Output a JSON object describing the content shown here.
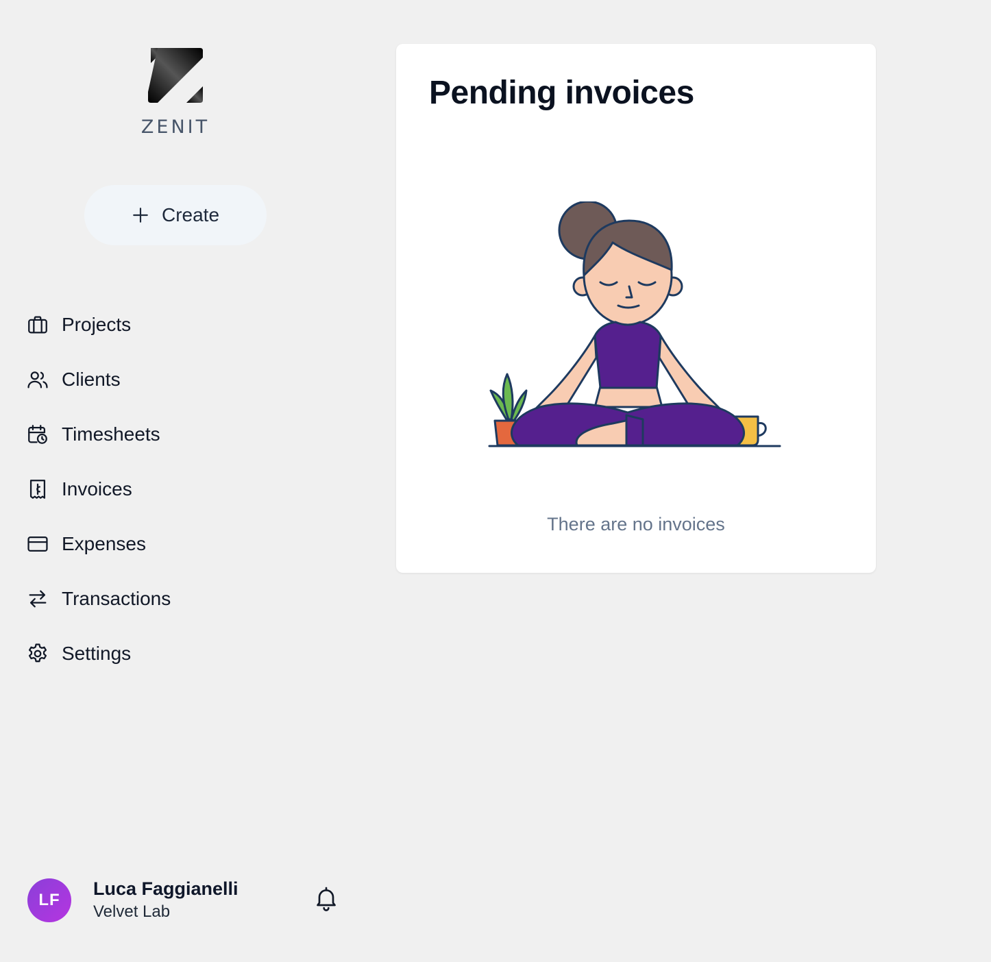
{
  "sidebar": {
    "brand": "ZENIT",
    "create_label": "Create",
    "nav": [
      {
        "label": "Projects",
        "icon": "briefcase-icon"
      },
      {
        "label": "Clients",
        "icon": "users-icon"
      },
      {
        "label": "Timesheets",
        "icon": "calendar-clock-icon"
      },
      {
        "label": "Invoices",
        "icon": "receipt-icon"
      },
      {
        "label": "Expenses",
        "icon": "credit-card-icon"
      },
      {
        "label": "Transactions",
        "icon": "arrows-exchange-icon"
      },
      {
        "label": "Settings",
        "icon": "gear-icon"
      }
    ],
    "user": {
      "initials": "LF",
      "name": "Luca Faggianelli",
      "org": "Velvet Lab"
    }
  },
  "card": {
    "title": "Pending invoices",
    "empty_message": "There are no invoices"
  },
  "colors": {
    "background": "#f0f0f0",
    "card": "#ffffff",
    "avatar": "#a03be0",
    "illustration_purple": "#55208e",
    "skin": "#f8ccb2",
    "hair": "#6e5a57",
    "mug": "#f4bf45",
    "pot": "#e4683e",
    "leaf": "#6cb950"
  }
}
